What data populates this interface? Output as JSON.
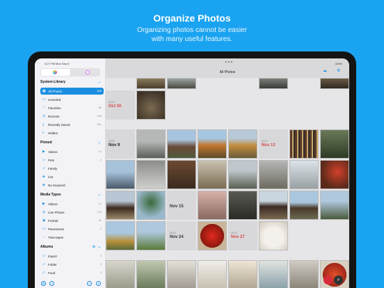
{
  "promo": {
    "headline": "Organize Photos",
    "subline1": "Organizing photos cannot be easier",
    "subline2": "with many useful features."
  },
  "status": {
    "time": "3:27 PM   Mon Sep 8",
    "battery": "100%"
  },
  "sidebar": {
    "system_library": "System Library",
    "system_items": [
      {
        "label": "All Photos",
        "count": "649",
        "icon": "grid-icon",
        "selected": true
      },
      {
        "label": "Unsorted",
        "count": "",
        "icon": "tray-icon"
      },
      {
        "label": "Favorites",
        "count": "66",
        "icon": "heart-icon"
      },
      {
        "label": "Recents",
        "count": "649",
        "icon": "clock-icon"
      },
      {
        "label": "Recently Saved",
        "count": "641",
        "icon": "download-icon"
      },
      {
        "label": "Hidden",
        "count": "",
        "icon": "eye-slash-icon"
      }
    ],
    "pinned": "Pinned",
    "pinned_items": [
      {
        "label": "Videos",
        "count": "14",
        "icon": "video-icon"
      },
      {
        "label": "Pets",
        "count": "4",
        "icon": "folder-icon"
      },
      {
        "label": "Family",
        "count": "",
        "icon": "folder-icon"
      },
      {
        "label": "Cat",
        "count": "",
        "icon": "tag-icon"
      },
      {
        "label": "No Keyword",
        "count": "",
        "icon": "tag-icon"
      }
    ],
    "media_types": "Media Types",
    "media_items": [
      {
        "label": "Videos",
        "count": "14",
        "icon": "video-icon"
      },
      {
        "label": "Live Photos",
        "count": "219",
        "icon": "live-icon"
      },
      {
        "label": "Portrait",
        "count": "81",
        "icon": "portrait-icon"
      },
      {
        "label": "Panoramas",
        "count": "3",
        "icon": "panorama-icon"
      },
      {
        "label": "Time-lapse",
        "count": "",
        "icon": "timelapse-icon"
      }
    ],
    "albums": "Albums",
    "album_items": [
      {
        "label": "Import",
        "count": "5",
        "icon": "folder-icon"
      },
      {
        "label": "Folder",
        "count": "5",
        "icon": "folder-icon"
      },
      {
        "label": "Food",
        "count": "3",
        "icon": "folder-icon"
      }
    ]
  },
  "main": {
    "title": "All Photos",
    "dates": [
      {
        "year": "2022",
        "date": "Oct 30"
      },
      {
        "year": "2022",
        "date": "Nov 9"
      },
      {
        "year": "2022",
        "date": "Nov 13"
      },
      {
        "year": "",
        "date": "Nov 15"
      },
      {
        "year": "2022",
        "date": "Nov 24"
      },
      {
        "year": "2022",
        "date": "Nov 27"
      }
    ]
  },
  "colors": {
    "accent": "#1a8fe0",
    "background": "#1aa3f0",
    "date_red": "#d94848"
  }
}
